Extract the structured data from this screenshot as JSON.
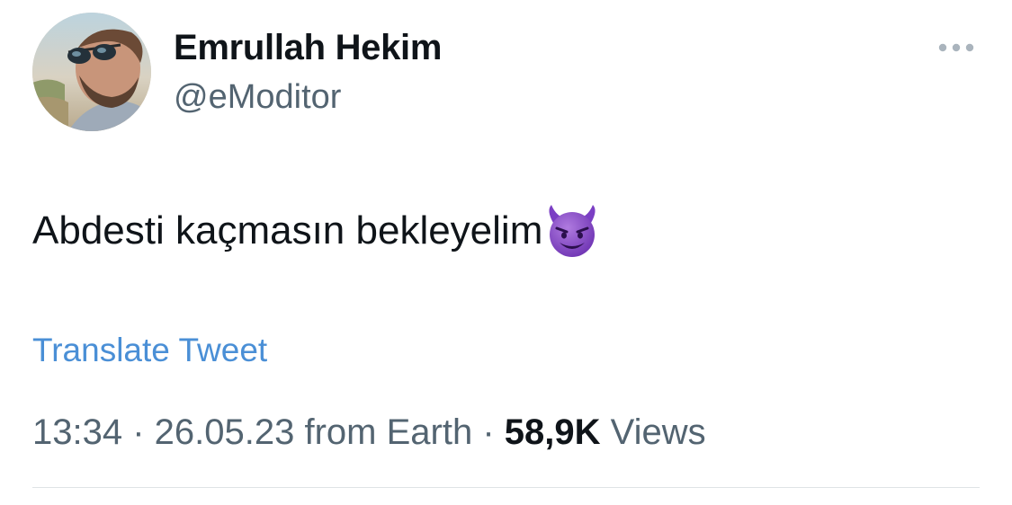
{
  "user": {
    "display_name": "Emrullah Hekim",
    "handle": "@eModitor",
    "avatar_icon": "profile-photo"
  },
  "header": {
    "more_icon": "more-horizontal-icon"
  },
  "tweet": {
    "text": "Abdesti kaçmasın bekleyelim",
    "emoji_icon": "smiling-devil-emoji"
  },
  "translate": {
    "label": "Translate Tweet",
    "color": "#4a8fd6"
  },
  "meta": {
    "time": "13:34",
    "sep1": " · ",
    "date": "26.05.23",
    "source": " from Earth",
    "sep2": " · ",
    "views_count": "58,9K",
    "views_label": " Views"
  },
  "colors": {
    "text_primary": "#0f1419",
    "text_secondary": "#536471",
    "divider": "#dfe3e6"
  }
}
